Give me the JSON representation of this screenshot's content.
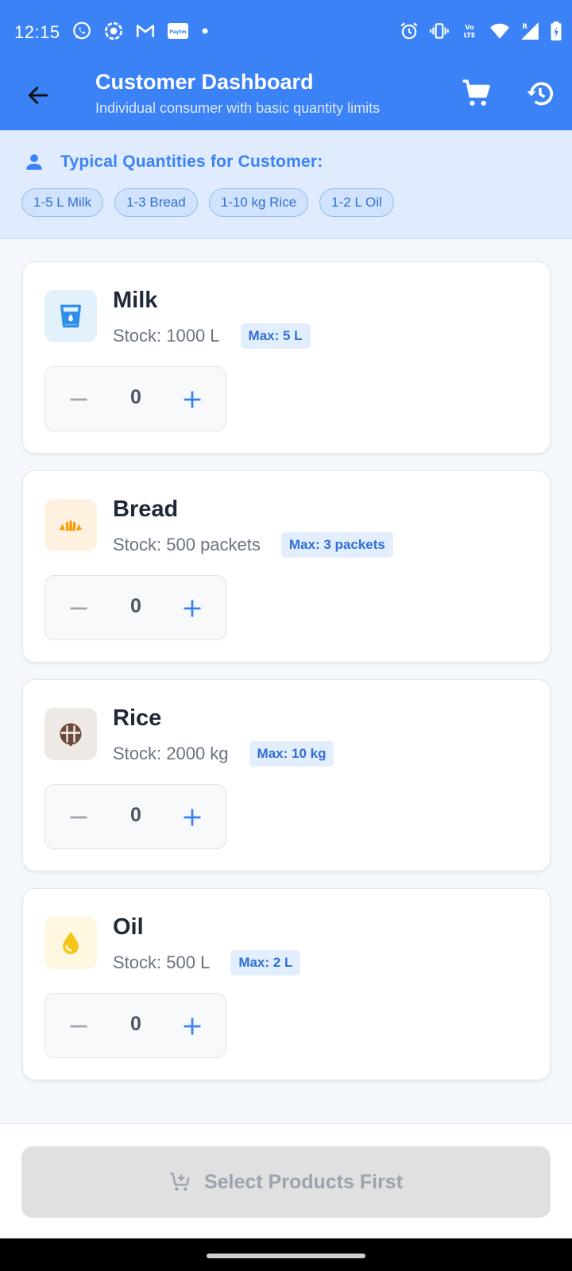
{
  "status_bar": {
    "time": "12:15",
    "left_icons": [
      "whatsapp-icon",
      "screen-record-icon",
      "gmail-icon",
      "paytm-icon",
      "dot-icon"
    ],
    "right_icons": [
      "alarm-icon",
      "vibrate-icon",
      "volte-icon",
      "wifi-icon",
      "signal-icon",
      "battery-icon"
    ]
  },
  "app_bar": {
    "title": "Customer Dashboard",
    "subtitle": "Individual consumer with basic quantity limits",
    "back_icon": "arrow-back-icon",
    "actions": [
      "cart-icon",
      "history-icon"
    ]
  },
  "typical_quantities": {
    "title": "Typical Quantities for Customer:",
    "icon": "person-icon",
    "chips": [
      "1-5 L Milk",
      "1-3 Bread",
      "1-10 kg Rice",
      "1-2 L Oil"
    ]
  },
  "products": [
    {
      "name": "Milk",
      "stock": "Stock: 1000 L",
      "max": "Max: 5 L",
      "quantity": "0",
      "icon": "milk-glass-icon",
      "icon_color": "#2f8fe8",
      "icon_bg": "#e3f1fd"
    },
    {
      "name": "Bread",
      "stock": "Stock: 500 packets",
      "max": "Max: 3 packets",
      "quantity": "0",
      "icon": "bread-icon",
      "icon_color": "#f59e0b",
      "icon_bg": "#fff1e0"
    },
    {
      "name": "Rice",
      "stock": "Stock: 2000 kg",
      "max": "Max: 10 kg",
      "quantity": "0",
      "icon": "rice-bowl-icon",
      "icon_color": "#6b4a3a",
      "icon_bg": "#efe9e6"
    },
    {
      "name": "Oil",
      "stock": "Stock: 500 L",
      "max": "Max: 2 L",
      "quantity": "0",
      "icon": "oil-drop-icon",
      "icon_color": "#f5c518",
      "icon_bg": "#fff8e1"
    }
  ],
  "bottom_button": {
    "label": "Select Products First",
    "icon": "add-cart-icon",
    "enabled": false
  },
  "colors": {
    "primary": "#3b82f6",
    "minus_disabled": "#9ca3af",
    "plus": "#3b82f6"
  }
}
